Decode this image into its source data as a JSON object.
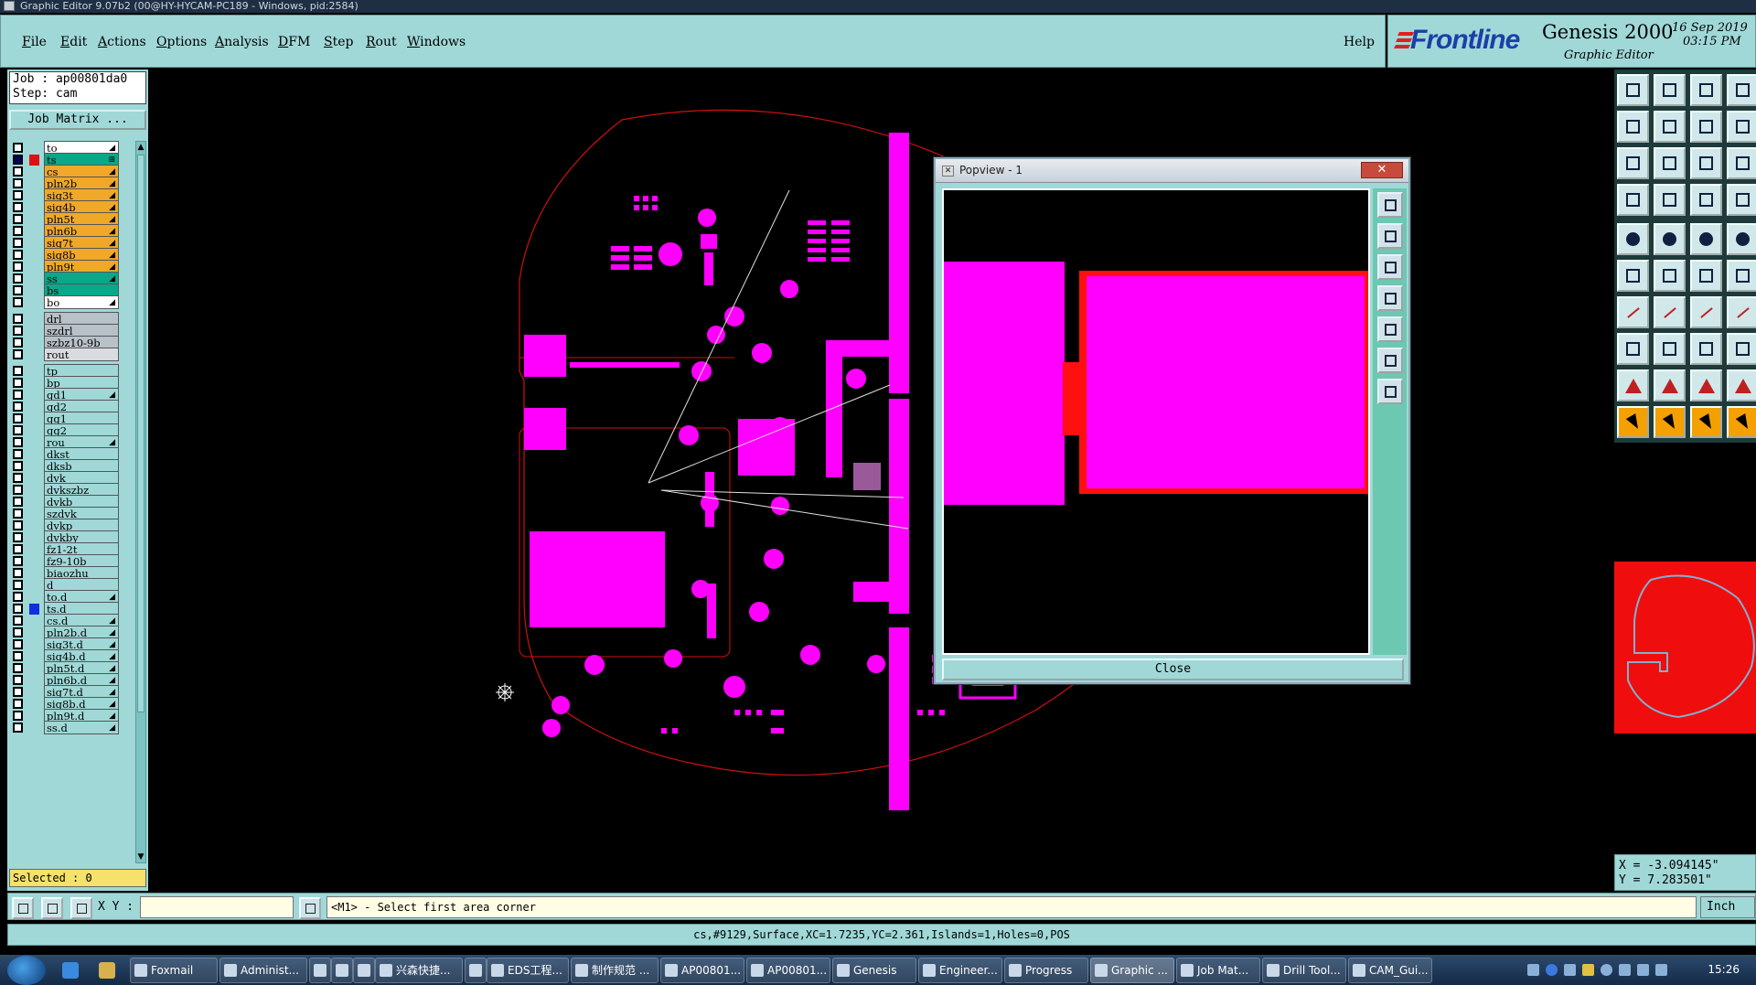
{
  "window": {
    "title": "Graphic Editor 9.07b2 (00@HY-HYCAM-PC189 - Windows, pid:2584)"
  },
  "menu": {
    "items": [
      {
        "label": "File",
        "u": "F"
      },
      {
        "label": "Edit",
        "u": "E"
      },
      {
        "label": "Actions",
        "u": "A"
      },
      {
        "label": "Options",
        "u": "O"
      },
      {
        "label": "Analysis",
        "u": "A"
      },
      {
        "label": "DFM",
        "u": "D"
      },
      {
        "label": "Step",
        "u": "S"
      },
      {
        "label": "Rout",
        "u": "R"
      },
      {
        "label": "Windows",
        "u": "W"
      }
    ],
    "help": "Help"
  },
  "brand": {
    "logo": "Frontline",
    "product": "Genesis 2000",
    "subtitle": "Graphic Editor",
    "date": "16 Sep 2019",
    "time": "03:15 PM"
  },
  "job": {
    "job_line": "Job : ap00801da0",
    "step_line": "Step: cam",
    "matrix_button": "Job Matrix ...",
    "selected": "Selected : 0"
  },
  "layers": [
    {
      "name": "to",
      "color": "#ffffff",
      "swatch": "",
      "arrow": "◢"
    },
    {
      "name": "ts",
      "color": "#0aa88a",
      "swatch": "#e01010",
      "arrow": "⊞",
      "checked": true
    },
    {
      "name": "cs",
      "color": "#f0a828",
      "swatch": "",
      "arrow": "◢"
    },
    {
      "name": "pln2b",
      "color": "#f0a828",
      "swatch": "",
      "arrow": "◢"
    },
    {
      "name": "sig3t",
      "color": "#f0a828",
      "swatch": "",
      "arrow": "◢"
    },
    {
      "name": "sig4b",
      "color": "#f0a828",
      "swatch": "",
      "arrow": "◢"
    },
    {
      "name": "pln5t",
      "color": "#f0a828",
      "swatch": "",
      "arrow": "◢"
    },
    {
      "name": "pln6b",
      "color": "#f0a828",
      "swatch": "",
      "arrow": "◢"
    },
    {
      "name": "sig7t",
      "color": "#f0a828",
      "swatch": "",
      "arrow": "◢"
    },
    {
      "name": "sig8b",
      "color": "#f0a828",
      "swatch": "",
      "arrow": "◢"
    },
    {
      "name": "pln9t",
      "color": "#f0a828",
      "swatch": "",
      "arrow": "◢"
    },
    {
      "name": "ss",
      "color": "#0aa88a",
      "swatch": "",
      "arrow": "◢"
    },
    {
      "name": "bs",
      "color": "#0aa88a",
      "swatch": "",
      "arrow": ""
    },
    {
      "name": "bo",
      "color": "#ffffff",
      "swatch": "",
      "arrow": "◢"
    },
    {
      "name": "drl",
      "color": "#b8c0c8",
      "swatch": "",
      "arrow": "",
      "gap": true
    },
    {
      "name": "szdrl",
      "color": "#b8c0c8",
      "swatch": "",
      "arrow": ""
    },
    {
      "name": "szbz10-9b",
      "color": "#b8c0c8",
      "swatch": "",
      "arrow": ""
    },
    {
      "name": "rout",
      "color": "#d8dce0",
      "swatch": "",
      "arrow": ""
    },
    {
      "name": "tp",
      "color": "#a0d8d8",
      "swatch": "",
      "arrow": "",
      "gap": true
    },
    {
      "name": "bp",
      "color": "#a0d8d8",
      "swatch": "",
      "arrow": ""
    },
    {
      "name": "gd1",
      "color": "#a0d8d8",
      "swatch": "",
      "arrow": "◢"
    },
    {
      "name": "gd2",
      "color": "#a0d8d8",
      "swatch": "",
      "arrow": ""
    },
    {
      "name": "gg1",
      "color": "#a0d8d8",
      "swatch": "",
      "arrow": ""
    },
    {
      "name": "gg2",
      "color": "#a0d8d8",
      "swatch": "",
      "arrow": ""
    },
    {
      "name": "rou",
      "color": "#a0d8d8",
      "swatch": "",
      "arrow": "◢"
    },
    {
      "name": "dkst",
      "color": "#a0d8d8",
      "swatch": "",
      "arrow": ""
    },
    {
      "name": "dksb",
      "color": "#a0d8d8",
      "swatch": "",
      "arrow": ""
    },
    {
      "name": "dvk",
      "color": "#a0d8d8",
      "swatch": "",
      "arrow": ""
    },
    {
      "name": "dvkszbz",
      "color": "#a0d8d8",
      "swatch": "",
      "arrow": ""
    },
    {
      "name": "dvkb",
      "color": "#a0d8d8",
      "swatch": "",
      "arrow": ""
    },
    {
      "name": "szdvk",
      "color": "#a0d8d8",
      "swatch": "",
      "arrow": ""
    },
    {
      "name": "dvkp",
      "color": "#a0d8d8",
      "swatch": "",
      "arrow": ""
    },
    {
      "name": "dvkby",
      "color": "#a0d8d8",
      "swatch": "",
      "arrow": ""
    },
    {
      "name": "fz1-2t",
      "color": "#a0d8d8",
      "swatch": "",
      "arrow": ""
    },
    {
      "name": "fz9-10b",
      "color": "#a0d8d8",
      "swatch": "",
      "arrow": ""
    },
    {
      "name": "biaozhu",
      "color": "#a0d8d8",
      "swatch": "",
      "arrow": ""
    },
    {
      "name": "d",
      "color": "#a0d8d8",
      "swatch": "",
      "arrow": ""
    },
    {
      "name": "to.d",
      "color": "#a0d8d8",
      "swatch": "",
      "arrow": "◢"
    },
    {
      "name": "ts.d",
      "color": "#a0d8d8",
      "swatch": "#1030e0",
      "arrow": ""
    },
    {
      "name": "cs.d",
      "color": "#a0d8d8",
      "swatch": "",
      "arrow": "◢"
    },
    {
      "name": "pln2b.d",
      "color": "#a0d8d8",
      "swatch": "",
      "arrow": "◢"
    },
    {
      "name": "sig3t.d",
      "color": "#a0d8d8",
      "swatch": "",
      "arrow": "◢"
    },
    {
      "name": "sig4b.d",
      "color": "#a0d8d8",
      "swatch": "",
      "arrow": "◢"
    },
    {
      "name": "pln5t.d",
      "color": "#a0d8d8",
      "swatch": "",
      "arrow": "◢"
    },
    {
      "name": "pln6b.d",
      "color": "#a0d8d8",
      "swatch": "",
      "arrow": "◢"
    },
    {
      "name": "sig7t.d",
      "color": "#a0d8d8",
      "swatch": "",
      "arrow": "◢"
    },
    {
      "name": "sig8b.d",
      "color": "#a0d8d8",
      "swatch": "",
      "arrow": "◢"
    },
    {
      "name": "pln9t.d",
      "color": "#a0d8d8",
      "swatch": "",
      "arrow": "◢"
    },
    {
      "name": "ss.d",
      "color": "#a0d8d8",
      "swatch": "",
      "arrow": "◢"
    }
  ],
  "popview": {
    "title": "Popview - 1",
    "close_x": "✕",
    "close_button": "Close"
  },
  "status": {
    "xy_label": "X Y :",
    "xy_value": "",
    "prompt": "<M1> - Select first area corner",
    "units": "Inch",
    "info": "cs,#9129,Surface,XC=1.7235,YC=2.361,Islands=1,Holes=0,POS"
  },
  "coords": {
    "x": "X = -3.094145\"",
    "y": "Y = 7.283501\""
  },
  "colors": {
    "feature": "#ff00ff",
    "outline": "#d01010",
    "panel": "#a0d8d8",
    "highlight": "#f4a000"
  },
  "taskbar": {
    "tasks": [
      {
        "label": "Foxmail",
        "w": 96
      },
      {
        "label": "Administ...",
        "w": 96
      },
      {
        "label": "",
        "w": 22
      },
      {
        "label": "",
        "w": 22
      },
      {
        "label": "",
        "w": 22
      },
      {
        "label": "兴森快捷...",
        "w": 96
      },
      {
        "label": "",
        "w": 22
      },
      {
        "label": "EDS工程...",
        "w": 90
      },
      {
        "label": "制作规范 ...",
        "w": 96
      },
      {
        "label": "AP00801...",
        "w": 92
      },
      {
        "label": "AP00801...",
        "w": 92
      },
      {
        "label": "Genesis",
        "w": 92
      },
      {
        "label": "Engineer...",
        "w": 92
      },
      {
        "label": "Progress",
        "w": 92
      },
      {
        "label": "Graphic ...",
        "w": 92,
        "active": true
      },
      {
        "label": "Job Mat...",
        "w": 92
      },
      {
        "label": "Drill Tool...",
        "w": 92
      },
      {
        "label": "CAM_Gui...",
        "w": 92
      }
    ],
    "clock": "15:26"
  }
}
